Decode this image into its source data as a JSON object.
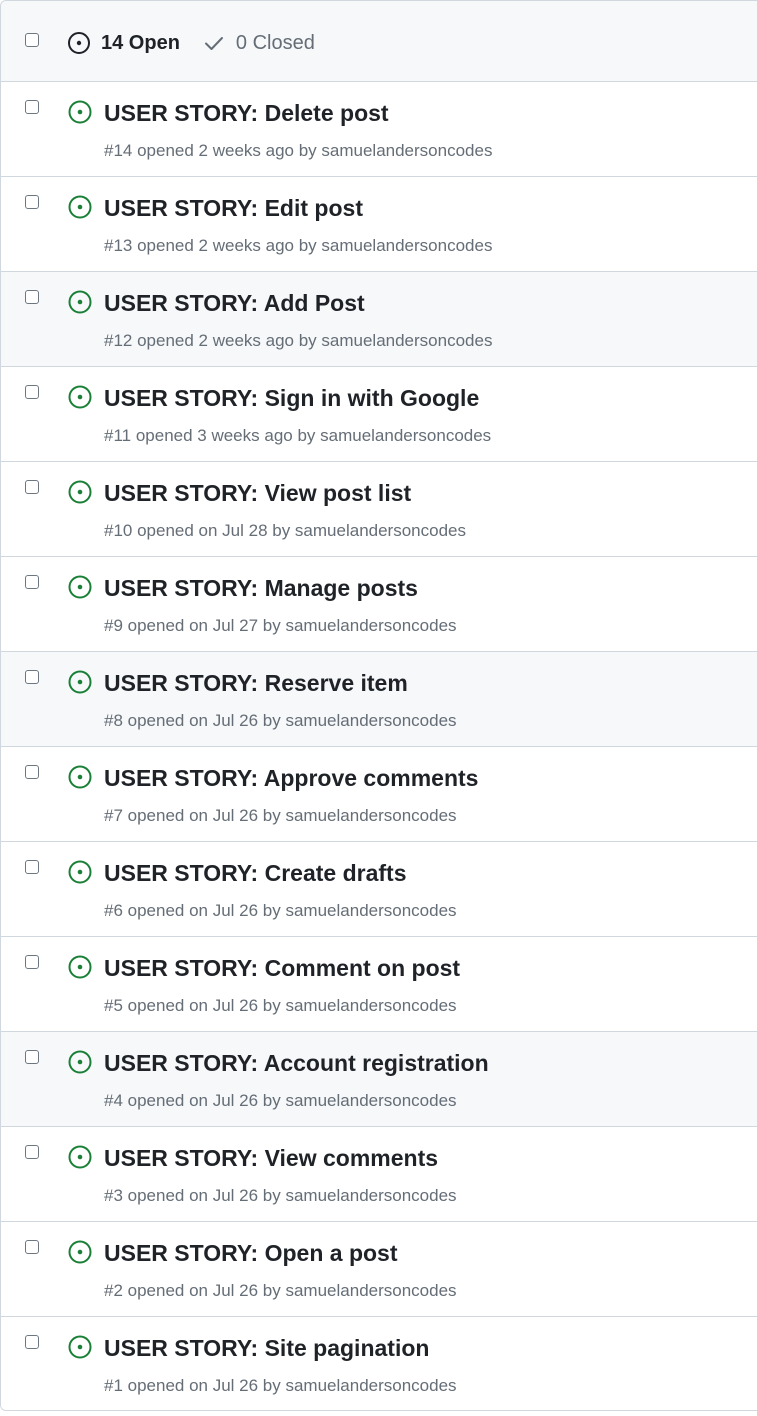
{
  "header": {
    "open_label": "14 Open",
    "closed_label": "0 Closed"
  },
  "colors": {
    "open_icon": "#1a7f37",
    "muted": "#656d76",
    "border": "#d0d7de"
  },
  "issues": [
    {
      "title": "USER STORY: Delete post",
      "meta": "#14 opened 2 weeks ago by samuelandersoncodes"
    },
    {
      "title": "USER STORY: Edit post",
      "meta": "#13 opened 2 weeks ago by samuelandersoncodes"
    },
    {
      "title": "USER STORY: Add Post",
      "meta": "#12 opened 2 weeks ago by samuelandersoncodes"
    },
    {
      "title": "USER STORY: Sign in with Google",
      "meta": "#11 opened 3 weeks ago by samuelandersoncodes"
    },
    {
      "title": "USER STORY: View post list",
      "meta": "#10 opened on Jul 28 by samuelandersoncodes"
    },
    {
      "title": "USER STORY: Manage posts",
      "meta": "#9 opened on Jul 27 by samuelandersoncodes"
    },
    {
      "title": "USER STORY: Reserve item",
      "meta": "#8 opened on Jul 26 by samuelandersoncodes"
    },
    {
      "title": "USER STORY: Approve comments",
      "meta": "#7 opened on Jul 26 by samuelandersoncodes"
    },
    {
      "title": "USER STORY: Create drafts",
      "meta": "#6 opened on Jul 26 by samuelandersoncodes"
    },
    {
      "title": "USER STORY: Comment on post",
      "meta": "#5 opened on Jul 26 by samuelandersoncodes"
    },
    {
      "title": "USER STORY: Account registration",
      "meta": "#4 opened on Jul 26 by samuelandersoncodes"
    },
    {
      "title": "USER STORY: View comments",
      "meta": "#3 opened on Jul 26 by samuelandersoncodes"
    },
    {
      "title": "USER STORY: Open a post",
      "meta": "#2 opened on Jul 26 by samuelandersoncodes"
    },
    {
      "title": "USER STORY: Site pagination",
      "meta": "#1 opened on Jul 26 by samuelandersoncodes"
    }
  ]
}
